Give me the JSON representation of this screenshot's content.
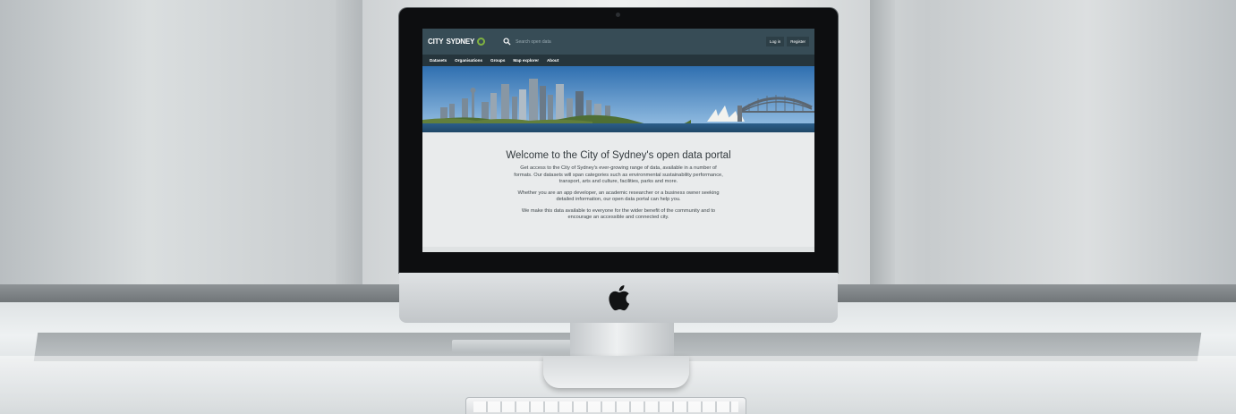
{
  "site": {
    "logo_text": "CITY",
    "logo_text_b": "SYDNEY",
    "search_placeholder": "Search open data",
    "header_buttons": [
      "Log in",
      "Register"
    ],
    "nav": [
      "Datasets",
      "Organisations",
      "Groups",
      "Map explorer",
      "About"
    ],
    "welcome_title": "Welcome to the City of Sydney's open data portal",
    "paragraphs": [
      "Get access to the City of Sydney's ever-growing range of data, available in a number of formats. Our datasets will span categories such as environmental sustainability performance, transport, arts and culture, facilities, parks and more.",
      "Whether you are an app developer, an academic researcher or a business owner seeking detailed information, our open data portal can help you.",
      "We make this data available to everyone for the wider benefit of the community and to encourage an accessible and connected city."
    ]
  },
  "colors": {
    "header_bg": "#374c56",
    "nav_bg": "#26353c",
    "logo_accent": "#7fb241",
    "page_bg": "#e9ebec"
  },
  "icons": {
    "search": "search-icon",
    "apple": "apple-logo-icon",
    "logo_mark": "city-of-sydney-logo-mark"
  }
}
